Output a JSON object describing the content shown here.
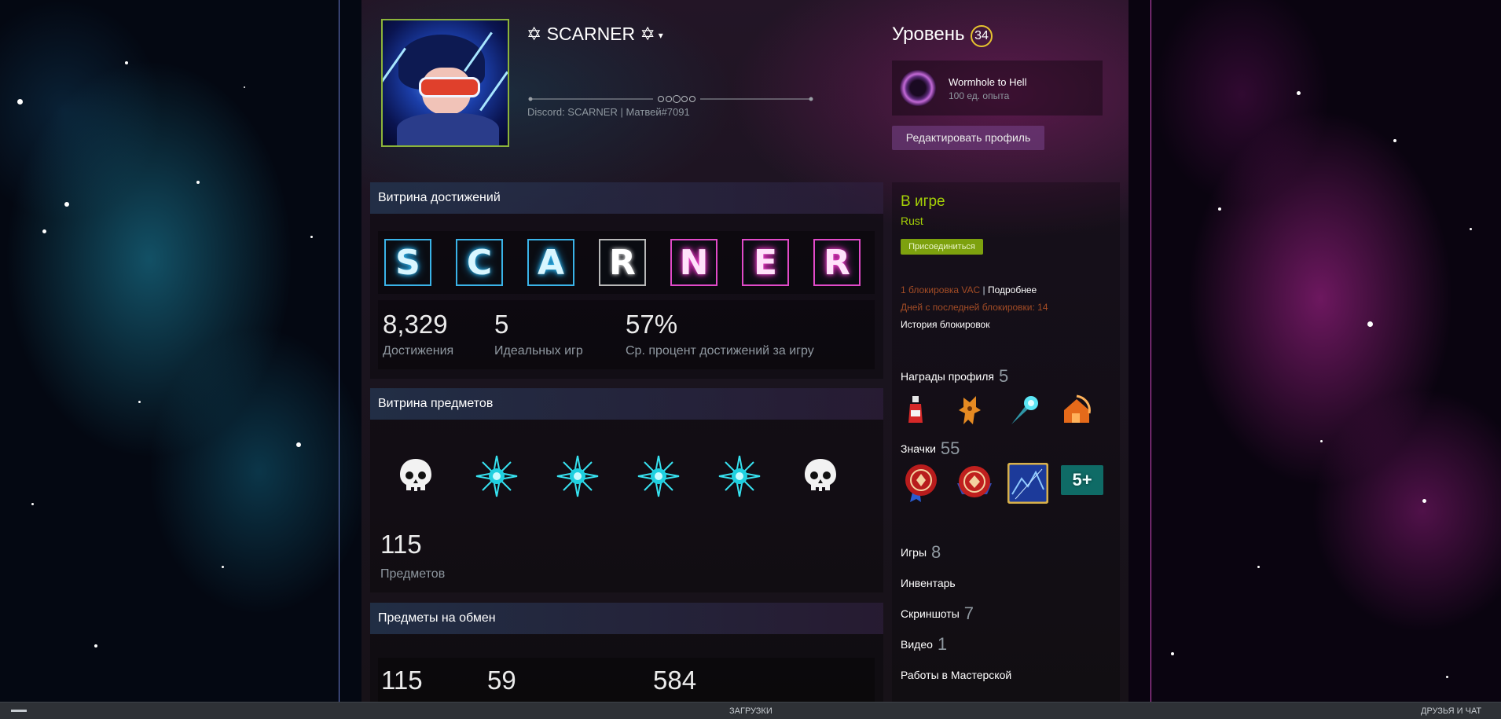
{
  "profile": {
    "persona_name": "✡ SCARNER ✡",
    "dropdown_caret": "▾",
    "summary": "Discord: SCARNER | Матвей#7091"
  },
  "level": {
    "title": "Уровень",
    "value": "34",
    "accent_color": "#e5c32f"
  },
  "favorite_badge": {
    "name": "Wormhole to Hell",
    "xp": "100 ед. опыта"
  },
  "edit_profile_label": "Редактировать профиль",
  "achievement_showcase": {
    "title": "Витрина достижений",
    "tiles": [
      {
        "letter": "S",
        "style": "cyan"
      },
      {
        "letter": "C",
        "style": "cyan"
      },
      {
        "letter": "A",
        "style": "cyan"
      },
      {
        "letter": "R",
        "style": "white"
      },
      {
        "letter": "N",
        "style": "pink"
      },
      {
        "letter": "E",
        "style": "pink"
      },
      {
        "letter": "R",
        "style": "pink"
      }
    ],
    "stats": [
      {
        "value": "8,329",
        "label": "Достижения"
      },
      {
        "value": "5",
        "label": "Идеальных игр"
      },
      {
        "value": "57%",
        "label": "Ср. процент достижений за игру"
      }
    ]
  },
  "item_showcase": {
    "title": "Витрина предметов",
    "icons": [
      "skull-icon",
      "cyan-star-icon",
      "cyan-star-icon",
      "cyan-star-icon",
      "cyan-star-icon",
      "skull-icon"
    ],
    "count": "115",
    "count_label": "Предметов"
  },
  "trade_showcase": {
    "title": "Предметы на обмен",
    "values": [
      "115",
      "59",
      "584"
    ]
  },
  "status": {
    "title": "В игре",
    "game": "Rust",
    "join_label": "Присоединиться",
    "color": "#a4d007"
  },
  "vac": {
    "bans": "1 блокировка VAC",
    "separator": "|",
    "more": "Подробнее",
    "days_since": "Дней с последней блокировки: 14",
    "history": "История блокировок",
    "color": "#a34c25"
  },
  "sidebar": {
    "awards_label": "Награды профиля",
    "awards_count": "5",
    "award_icons": [
      "ketchup-bottle-icon",
      "orange-creature-icon",
      "blue-comet-icon",
      "orange-house-icon"
    ],
    "badges_label": "Значки",
    "badges_count": "55",
    "badge_icons": [
      "red-seal-ribbon-icon",
      "red-seal-icon",
      "blue-card-badge-icon",
      "level-5-plus-icon"
    ],
    "badge_five_plus_text": "5+",
    "games_label": "Игры",
    "games_count": "8",
    "inventory_label": "Инвентарь",
    "screenshots_label": "Скриншоты",
    "screenshots_count": "7",
    "videos_label": "Видео",
    "videos_count": "1",
    "workshop_label": "Работы в Мастерской"
  },
  "footer": {
    "downloads_label": "ЗАГРУЗКИ",
    "friends_label": "ДРУЗЬЯ И ЧАТ"
  }
}
